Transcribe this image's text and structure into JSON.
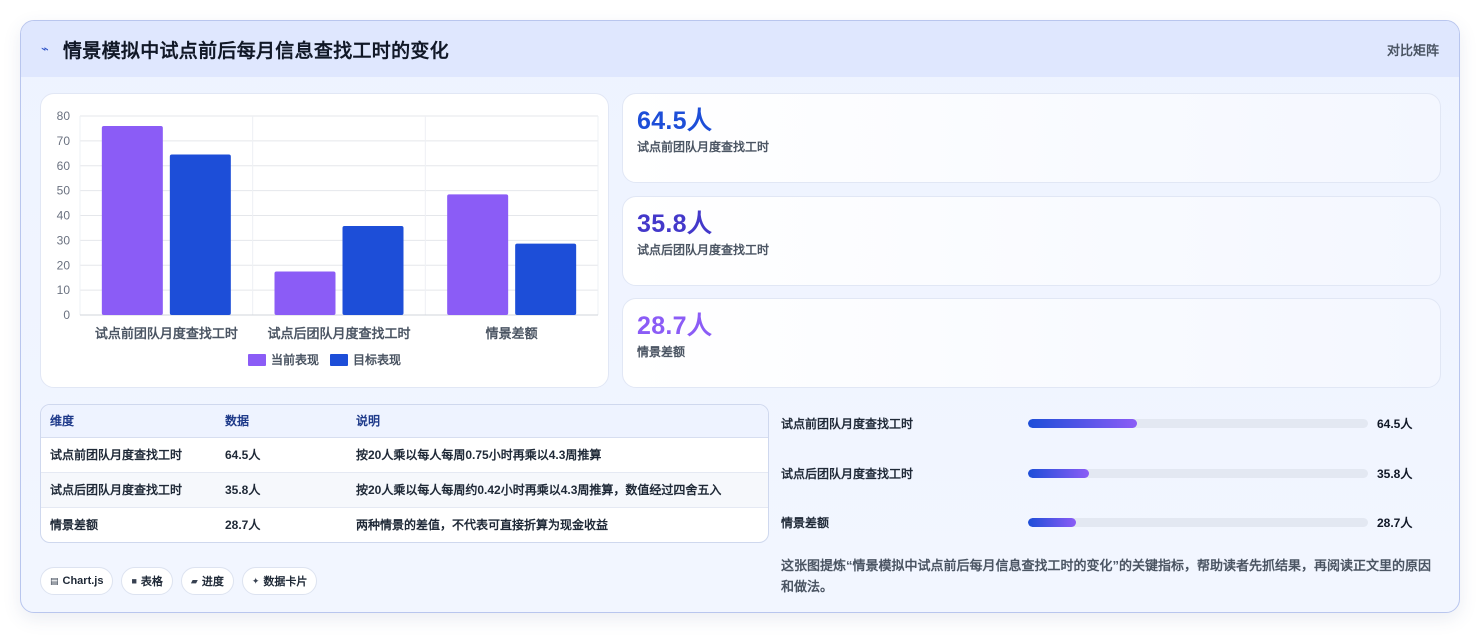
{
  "header": {
    "title": "情景模拟中试点前后每月信息查找工时的变化",
    "icon": "line-chart-icon",
    "action_label": "对比矩阵"
  },
  "chart_data": {
    "type": "bar",
    "categories": [
      "试点前团队月度查找工时",
      "试点后团队月度查找工时",
      "情景差额"
    ],
    "series": [
      {
        "name": "当前表现",
        "values": [
          76,
          17.5,
          48.5
        ],
        "color": "#8b5cf6"
      },
      {
        "name": "目标表现",
        "values": [
          64.5,
          35.8,
          28.7
        ],
        "color": "#1d4ed8"
      }
    ],
    "ylim": [
      0,
      80
    ],
    "yticks": [
      "0",
      "10",
      "20",
      "30",
      "40",
      "50",
      "60",
      "70",
      "80"
    ],
    "grid": true,
    "legend_position": "bottom"
  },
  "kpis": [
    {
      "value": "64.5人",
      "label": "试点前团队月度查找工时",
      "color": "#1d4ed8"
    },
    {
      "value": "35.8人",
      "label": "试点后团队月度查找工时",
      "color": "#4338ca"
    },
    {
      "value": "28.7人",
      "label": "情景差额",
      "color": "#8b5cf6"
    }
  ],
  "table": {
    "headers": [
      "维度",
      "数据",
      "说明"
    ],
    "rows": [
      [
        "试点前团队月度查找工时",
        "64.5人",
        "按20人乘以每人每周0.75小时再乘以4.3周推算"
      ],
      [
        "试点后团队月度查找工时",
        "35.8人",
        "按20人乘以每人每周约0.42小时再乘以4.3周推算，数值经过四舍五入"
      ],
      [
        "情景差额",
        "28.7人",
        "两种情景的差值，不代表可直接折算为现金收益"
      ]
    ]
  },
  "progress": [
    {
      "label": "试点前团队月度查找工时",
      "value": "64.5人",
      "fraction": 0.32
    },
    {
      "label": "试点后团队月度查找工时",
      "value": "35.8人",
      "fraction": 0.18
    },
    {
      "label": "情景差额",
      "value": "28.7人",
      "fraction": 0.14
    }
  ],
  "note": "这张图提炼“情景模拟中试点前后每月信息查找工时的变化”的关键指标，帮助读者先抓结果，再阅读正文里的原因和做法。",
  "tags": [
    {
      "icon": "chart-icon",
      "glyph": "▤",
      "label": "Chart.js"
    },
    {
      "icon": "table-icon",
      "glyph": "■",
      "label": "表格"
    },
    {
      "icon": "progress-icon",
      "glyph": "▰",
      "label": "进度"
    },
    {
      "icon": "sparkle-icon",
      "glyph": "✦",
      "label": "数据卡片"
    }
  ]
}
